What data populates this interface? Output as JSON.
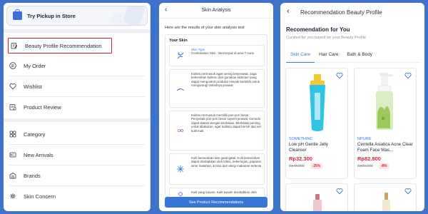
{
  "panel1": {
    "pickup_label": "Try Pickup in Store",
    "menu": [
      {
        "label": "Beauty Profile Recommendation",
        "icon": "clipboard-edit-icon"
      },
      {
        "label": "My Order",
        "icon": "list-icon"
      },
      {
        "label": "Wishlist",
        "icon": "heart-icon"
      },
      {
        "label": "Product Review",
        "icon": "review-icon"
      }
    ],
    "menu2": [
      {
        "label": "Category",
        "icon": "grid-icon"
      },
      {
        "label": "New Arrivals",
        "icon": "new-icon"
      },
      {
        "label": "Brands",
        "icon": "brands-icon"
      },
      {
        "label": "Skin Concern",
        "icon": "skin-concern-icon"
      }
    ]
  },
  "panel2": {
    "title": "Skin Analysis",
    "intro": "Here are the results of your skin analysis test",
    "card_title": "Your Skin",
    "results": [
      {
        "head": "Skin Type",
        "text": "Combination Skin : Berminyak di area T-zone"
      },
      {
        "head": "",
        "text": "Kulitmu termasuk agak sering berjerawat. Jaga kebersihan kulitmu dan gunakan skincare yang dapat mengontrol produksi minyak berlebih untuk mengurangi timbulnya jerawat"
      },
      {
        "head": "",
        "text": "Kulitmu termasuk memiliki pori-pori besar. Penyebab pori-pori besar seperti jerawat, komedo dapat diatasi dengan eksfoliasi. Eksfoliasi penting untuk dilakukan, agar kulitmu dapat bersih dari sel kulit mati"
      },
      {
        "head": "",
        "text": "Kulit kemerahan dan gatal-gatal. Kulit kemerahan dapat disebabkan oleh iritasi, kekeringan, paparan sinar matahari, & bisa dari alergi makanan tertentu"
      },
      {
        "head": "",
        "text": "Kulit yang kusam. Kulit kusam disebabkan oleh"
      }
    ],
    "button_label": "See Product Recommendations"
  },
  "panel3": {
    "title": "Recommendation Beauty Profile",
    "heading": "Recomendation for You",
    "subtitle": "Curated for you based on your Beauty Profile",
    "tabs": [
      "Skin Care",
      "Hair Care",
      "Bath & Body"
    ],
    "products": [
      {
        "brand": "SOMETHINC",
        "name": "Low pH Gentle Jelly Cleanser",
        "price": "Rp32.300",
        "old_price": "Rp43.000",
        "discount": "-25%",
        "bottle_color": "#2fc3e6"
      },
      {
        "brand": "NPURE",
        "name": "Centella Asiatica Acne Clear Foam Face Was...",
        "price": "Rp82.800",
        "old_price": "Rp90.000",
        "discount": "-8%",
        "bottle_color": "#9fc85a"
      }
    ],
    "accent": "#3a78d8"
  },
  "colors": {
    "background": "#3f73c9",
    "highlight_border": "#cc1f2d",
    "button": "#3576d6",
    "price": "#d02a3a"
  }
}
